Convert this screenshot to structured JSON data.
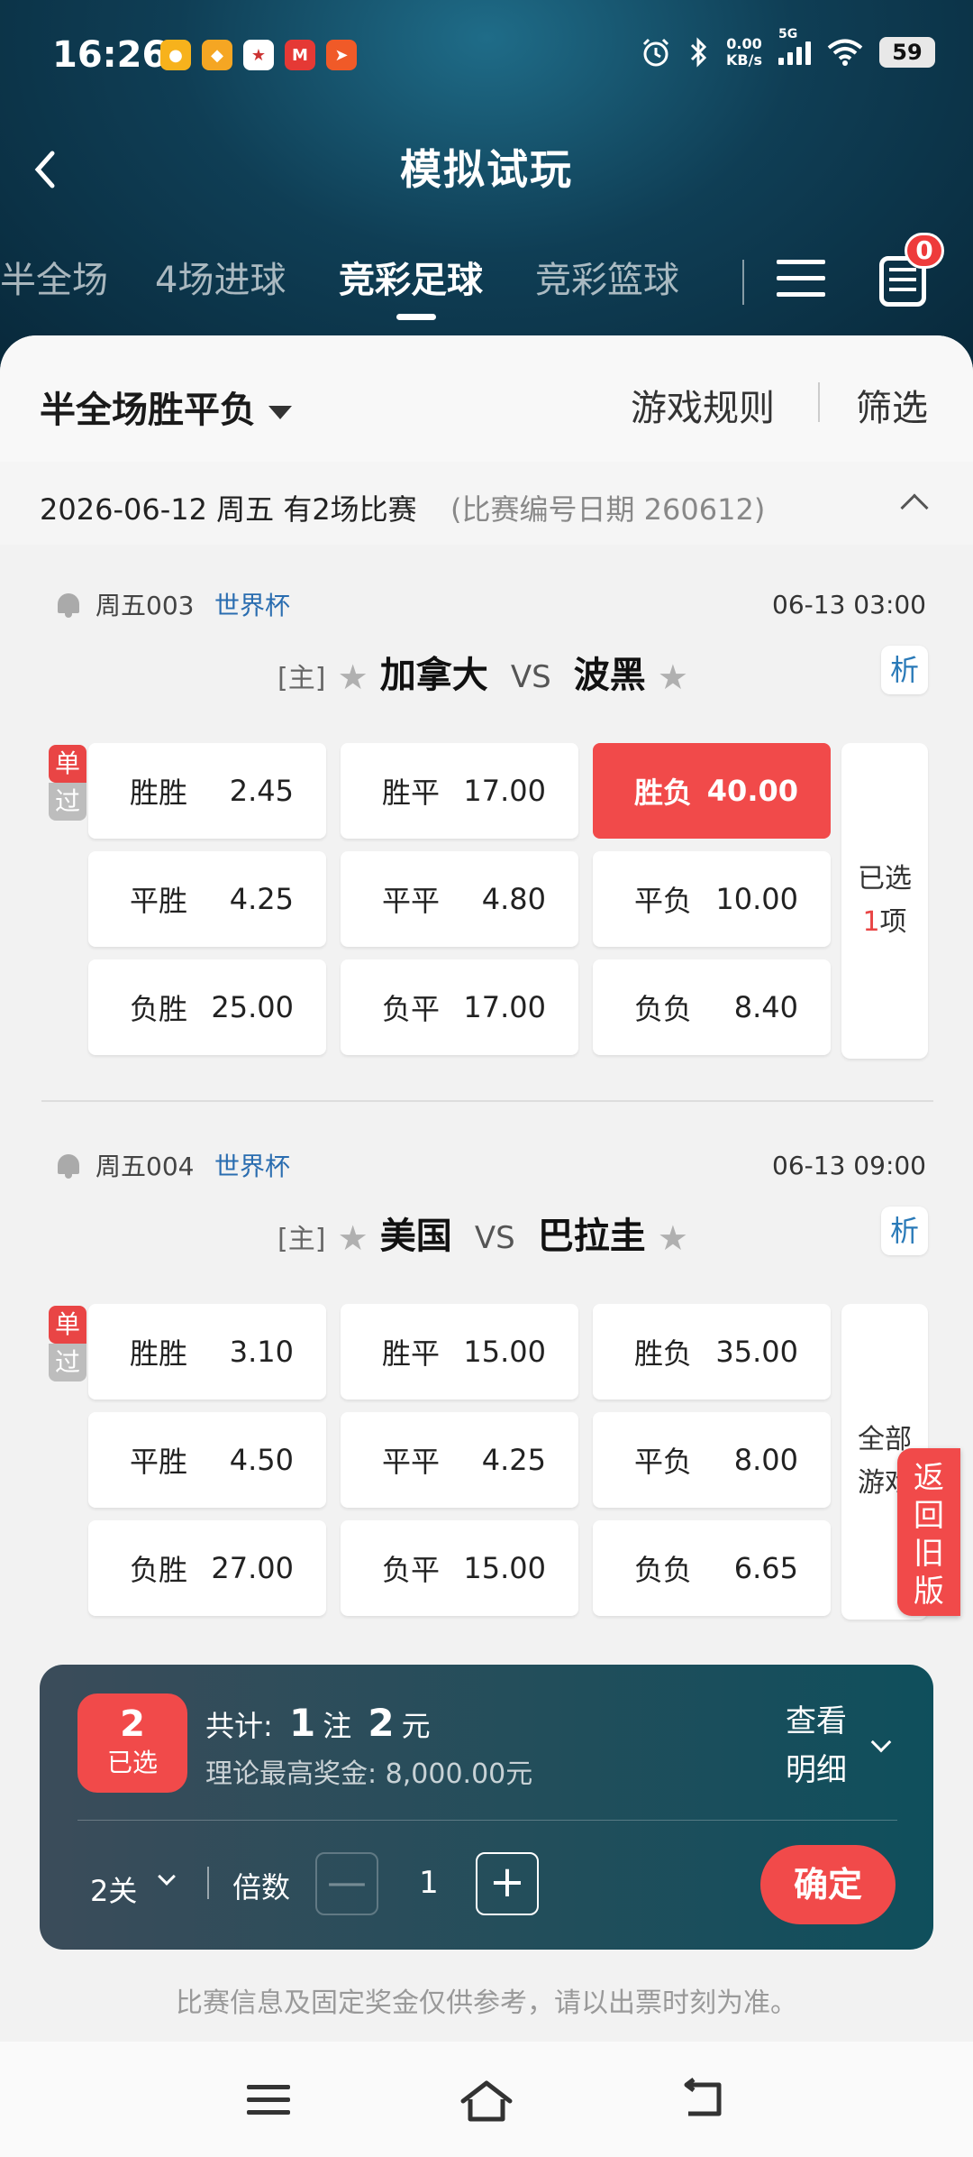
{
  "status_bar": {
    "time": "16:26",
    "net_speed_value": "0.00",
    "net_speed_unit": "KB/s",
    "network": "5G",
    "battery": "59",
    "icons": [
      "weibo-icon",
      "app-icon",
      "lottery-icon",
      "mcdonalds-icon",
      "delivery-icon",
      "alarm-icon",
      "bluetooth-icon",
      "signal-icon",
      "wifi-icon"
    ]
  },
  "header": {
    "title": "模拟试玩",
    "tabs": [
      "半全场",
      "4场进球",
      "竞彩足球",
      "竞彩篮球"
    ],
    "active_tab": "竞彩足球",
    "cart_count": "0"
  },
  "filter": {
    "play_type": "半全场胜平负",
    "rules": "游戏规则",
    "filter": "筛选"
  },
  "date_row": {
    "date": "2026-06-12 周五 有2场比赛",
    "note": "(比赛编号日期 260612)"
  },
  "tags": {
    "single": "单",
    "pass": "过"
  },
  "matches": [
    {
      "no": "周五003",
      "league": "世界杯",
      "time": "06-13 03:00",
      "home_tag": "[主]",
      "home": "加拿大",
      "vs": "VS",
      "away": "波黑",
      "analysis": "析",
      "odds": [
        {
          "label": "胜胜",
          "value": "2.45"
        },
        {
          "label": "胜平",
          "value": "17.00"
        },
        {
          "label": "胜负",
          "value": "40.00",
          "selected": true
        },
        {
          "label": "平胜",
          "value": "4.25"
        },
        {
          "label": "平平",
          "value": "4.80"
        },
        {
          "label": "平负",
          "value": "10.00"
        },
        {
          "label": "负胜",
          "value": "25.00"
        },
        {
          "label": "负平",
          "value": "17.00"
        },
        {
          "label": "负负",
          "value": "8.40"
        }
      ],
      "side_line1": "已选",
      "side_count": "1",
      "side_line2": "项"
    },
    {
      "no": "周五004",
      "league": "世界杯",
      "time": "06-13 09:00",
      "home_tag": "[主]",
      "home": "美国",
      "vs": "VS",
      "away": "巴拉圭",
      "analysis": "析",
      "odds": [
        {
          "label": "胜胜",
          "value": "3.10"
        },
        {
          "label": "胜平",
          "value": "15.00"
        },
        {
          "label": "胜负",
          "value": "35.00"
        },
        {
          "label": "平胜",
          "value": "4.50"
        },
        {
          "label": "平平",
          "value": "4.25"
        },
        {
          "label": "平负",
          "value": "8.00"
        },
        {
          "label": "负胜",
          "value": "27.00"
        },
        {
          "label": "负平",
          "value": "15.00"
        },
        {
          "label": "负负",
          "value": "6.65"
        }
      ],
      "side_line1": "全部",
      "side_line2": "游戏"
    }
  ],
  "return_old": "返回旧版",
  "bet_panel": {
    "selected_count": "2",
    "selected_label": "已选",
    "total_prefix": "共计:",
    "bets": "1",
    "bets_unit": "注",
    "amount": "2",
    "amount_unit": "元",
    "max_prize": "理论最高奖金: 8,000.00元",
    "detail": "查看明细",
    "pass_type": "2关",
    "multiple_label": "倍数",
    "minus": "—",
    "multiple": "1",
    "plus": "+",
    "confirm": "确定"
  },
  "disclaimer": "比赛信息及固定奖金仅供参考，请以出票时刻为准。"
}
